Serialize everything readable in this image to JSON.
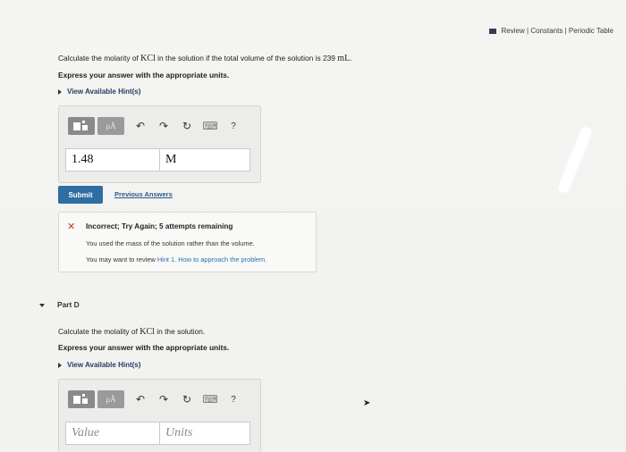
{
  "topbar": {
    "review": "Review",
    "sep": "|",
    "constants": "Constants",
    "sep2": "|",
    "periodic": "Periodic Table"
  },
  "partC": {
    "q_prefix": "Calculate the molarity of ",
    "q_chem": "KCl",
    "q_mid": " in the solution if the total volume of the solution is 239 ",
    "q_unit": "mL",
    "q_end": ".",
    "instruction": "Express your answer with the appropriate units.",
    "hints": "View Available Hint(s)",
    "value": "1.48",
    "units": "M",
    "submit": "Submit",
    "previous": "Previous Answers",
    "feedback": {
      "title": "Incorrect; Try Again; 5 attempts remaining",
      "line1": "You used the mass of the solution rather than the volume.",
      "line2_prefix": "You may want to review ",
      "line2_link": "Hint 1. How to approach the problem."
    }
  },
  "toolbar": {
    "mu_label": "μÅ",
    "undo": "↶",
    "redo": "↷",
    "reset": "↻",
    "keyboard": "⌨",
    "help": "?"
  },
  "partD": {
    "title": "Part D",
    "q_prefix": "Calculate the molality of ",
    "q_chem": "KCl",
    "q_end": " in the solution.",
    "instruction": "Express your answer with the appropriate units.",
    "hints": "View Available Hint(s)",
    "value_placeholder": "Value",
    "units_placeholder": "Units"
  }
}
